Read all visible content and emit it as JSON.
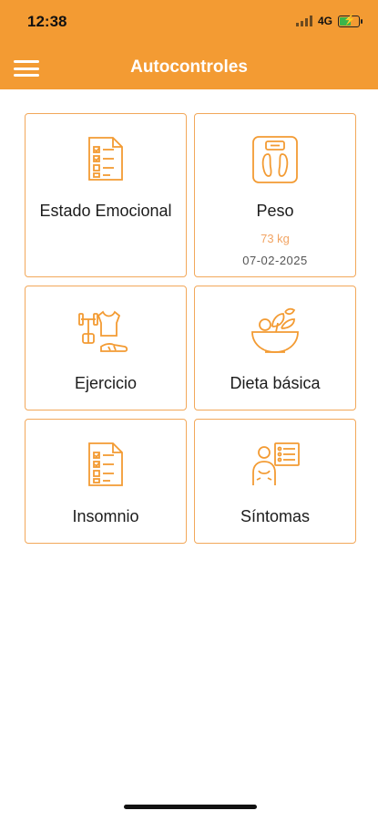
{
  "status_bar": {
    "time": "12:38",
    "network": "4G"
  },
  "header": {
    "title": "Autocontroles",
    "menu_icon": "hamburger-menu-icon"
  },
  "theme": {
    "accent": "#f39b33",
    "card_border": "#f2a85a",
    "value_color": "#f2a463"
  },
  "cards": [
    {
      "label": "Estado Emocional",
      "icon": "checklist-icon"
    },
    {
      "label": "Peso",
      "icon": "scale-icon",
      "value": "73 kg",
      "date": "07-02-2025"
    },
    {
      "label": "Ejercicio",
      "icon": "exercise-icon"
    },
    {
      "label": "Dieta básica",
      "icon": "salad-bowl-icon"
    },
    {
      "label": "Insomnio",
      "icon": "checklist-icon"
    },
    {
      "label": "Síntomas",
      "icon": "symptoms-icon"
    }
  ]
}
